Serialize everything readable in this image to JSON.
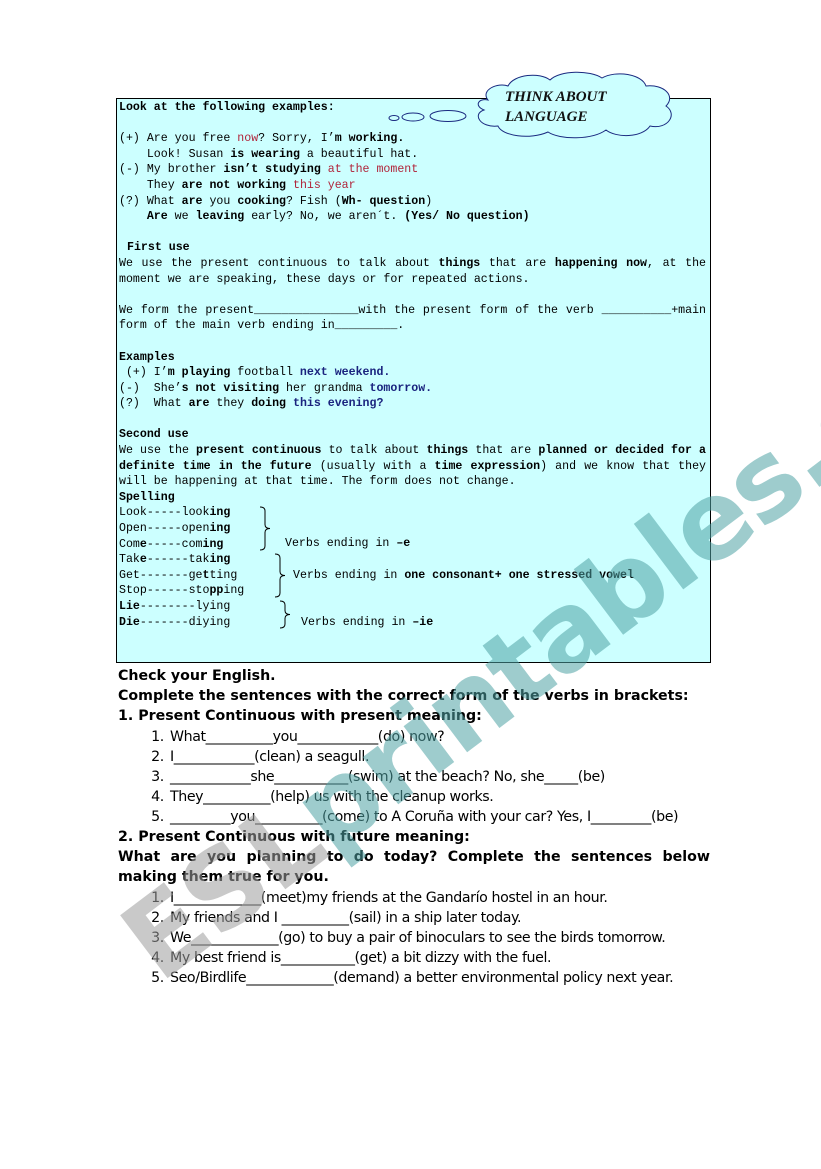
{
  "cloud": {
    "line1": "THINK ABOUT",
    "line2": "LANGUAGE"
  },
  "grammar_box": {
    "intro": "Look at the following examples:",
    "examples": [
      {
        "sign": "(+)",
        "parts": [
          {
            "t": "Are you free ",
            "s": ""
          },
          {
            "t": "now",
            "s": "red"
          },
          {
            "t": "? Sorry, I’",
            "s": ""
          },
          {
            "t": "m working.",
            "s": "b"
          }
        ]
      },
      {
        "sign": "",
        "parts": [
          {
            "t": "Look! Susan ",
            "s": ""
          },
          {
            "t": "is wearing",
            "s": "b"
          },
          {
            "t": " a beautiful hat.",
            "s": ""
          }
        ]
      },
      {
        "sign": "(-)",
        "parts": [
          {
            "t": "My brother ",
            "s": ""
          },
          {
            "t": "isn’t studying",
            "s": "b"
          },
          {
            "t": " ",
            "s": ""
          },
          {
            "t": "at the moment",
            "s": "red"
          }
        ]
      },
      {
        "sign": "",
        "parts": [
          {
            "t": "They ",
            "s": ""
          },
          {
            "t": "are not working",
            "s": "b"
          },
          {
            "t": " ",
            "s": ""
          },
          {
            "t": "this year",
            "s": "red"
          }
        ]
      },
      {
        "sign": "(?)",
        "parts": [
          {
            "t": "What ",
            "s": ""
          },
          {
            "t": "are",
            "s": "b"
          },
          {
            "t": " you ",
            "s": ""
          },
          {
            "t": "cooking",
            "s": "b"
          },
          {
            "t": "? Fish (",
            "s": ""
          },
          {
            "t": "Wh- question",
            "s": "b"
          },
          {
            "t": ")",
            "s": ""
          }
        ]
      },
      {
        "sign": "",
        "parts": [
          {
            "t": "Are",
            "s": "b"
          },
          {
            "t": " we ",
            "s": ""
          },
          {
            "t": "leaving",
            "s": "b"
          },
          {
            "t": " early? No, we aren´t. ",
            "s": ""
          },
          {
            "t": "(Yes/ No question)",
            "s": "b"
          }
        ]
      }
    ],
    "first_use": {
      "heading": "First use",
      "para_parts": [
        {
          "t": "We use the present continuous to talk about ",
          "s": ""
        },
        {
          "t": "things",
          "s": "b"
        },
        {
          "t": " that are ",
          "s": ""
        },
        {
          "t": "happening now",
          "s": "b"
        },
        {
          "t": ", at the moment we are speaking, these days or for repeated actions.",
          "s": ""
        }
      ],
      "form_sentence": "We form the present_______________with the present form of the verb __________+main form of the main verb ending in_________."
    },
    "examples2": {
      "heading": "Examples",
      "items": [
        {
          "sign": " (+)",
          "parts": [
            {
              "t": "I’",
              "s": ""
            },
            {
              "t": "m playing",
              "s": "b"
            },
            {
              "t": " football ",
              "s": ""
            },
            {
              "t": "next weekend.",
              "s": "blue"
            }
          ]
        },
        {
          "sign": "(-) ",
          "parts": [
            {
              "t": "She’",
              "s": ""
            },
            {
              "t": "s not visiting",
              "s": "b"
            },
            {
              "t": " her grandma ",
              "s": ""
            },
            {
              "t": "tomorrow.",
              "s": "blue"
            }
          ]
        },
        {
          "sign": "(?) ",
          "parts": [
            {
              "t": "What ",
              "s": ""
            },
            {
              "t": "are",
              "s": "b"
            },
            {
              "t": " they ",
              "s": ""
            },
            {
              "t": "doing",
              "s": "b"
            },
            {
              "t": " ",
              "s": ""
            },
            {
              "t": "this evening?",
              "s": "blue"
            }
          ]
        }
      ]
    },
    "second_use": {
      "heading": "Second use",
      "para_parts": [
        {
          "t": "We use the ",
          "s": ""
        },
        {
          "t": "present continuous",
          "s": "b"
        },
        {
          "t": " to talk about ",
          "s": ""
        },
        {
          "t": "things",
          "s": "b"
        },
        {
          "t": " that are ",
          "s": ""
        },
        {
          "t": "planned or decided for a definite time in the future",
          "s": "b"
        },
        {
          "t": " (usually with a ",
          "s": ""
        },
        {
          "t": "time expression",
          "s": "b"
        },
        {
          "t": ") and we know that they will be happening at that time. The form does not change.",
          "s": ""
        }
      ]
    },
    "spelling": {
      "heading": "Spelling",
      "rows": [
        {
          "parts": [
            {
              "t": "Look-----look",
              "s": ""
            },
            {
              "t": "ing",
              "s": "b"
            }
          ]
        },
        {
          "parts": [
            {
              "t": "Open-----open",
              "s": ""
            },
            {
              "t": "ing",
              "s": "b"
            }
          ]
        },
        {
          "parts": [
            {
              "t": "Com",
              "s": ""
            },
            {
              "t": "e",
              "s": "b"
            },
            {
              "t": "-----com",
              "s": ""
            },
            {
              "t": "ing",
              "s": "b"
            }
          ]
        },
        {
          "parts": [
            {
              "t": "Tak",
              "s": ""
            },
            {
              "t": "e",
              "s": "b"
            },
            {
              "t": "------tak",
              "s": ""
            },
            {
              "t": "ing",
              "s": "b"
            }
          ]
        },
        {
          "parts": [
            {
              "t": "Get-------ge",
              "s": ""
            },
            {
              "t": "t",
              "s": "b"
            },
            {
              "t": "ting",
              "s": ""
            }
          ]
        },
        {
          "parts": [
            {
              "t": "Stop------sto",
              "s": ""
            },
            {
              "t": "pp",
              "s": "b"
            },
            {
              "t": "ing",
              "s": ""
            }
          ]
        },
        {
          "parts": [
            {
              "t": "Lie",
              "s": "b"
            },
            {
              "t": "--------l",
              "s": ""
            },
            {
              "t": "y",
              "s": ""
            },
            {
              "t": "ing",
              "s": ""
            }
          ]
        },
        {
          "parts": [
            {
              "t": "Die",
              "s": "b"
            },
            {
              "t": "-------diying",
              "s": ""
            }
          ]
        }
      ],
      "notes": [
        {
          "parts": [
            {
              "t": "Verbs ending in ",
              "s": ""
            },
            {
              "t": "–e",
              "s": "b"
            }
          ]
        },
        {
          "parts": [
            {
              "t": "Verbs ending in ",
              "s": ""
            },
            {
              "t": "one consonant+ one stressed vowel",
              "s": "b"
            }
          ]
        },
        {
          "parts": [
            {
              "t": "Verbs ending in ",
              "s": ""
            },
            {
              "t": "–ie",
              "s": "b"
            }
          ]
        }
      ]
    }
  },
  "exercises": {
    "check_heading": "Check your English.",
    "instruction": "Complete the sentences with the correct form of the verbs in brackets:",
    "section1": {
      "title": "1. Present Continuous with present meaning:",
      "items": [
        "What__________you____________(do) now?",
        "I____________(clean) a seagull.",
        "____________she___________(swim) at the beach? No, she_____(be)",
        "They__________(help) us with the cleanup works.",
        "_________you__________(come) to A Coruña with your car? Yes, I_________(be)"
      ]
    },
    "section2": {
      "title": "2. Present Continuous with future meaning:",
      "instruction": "What are you planning to do today? Complete the sentences below making them true for you.",
      "items": [
        "I_____________(meet)my friends at the Gandarío hostel in an hour.",
        "My friends and I __________(sail) in a ship later today.",
        "We_____________(go) to buy a pair of binoculars to see the birds tomorrow.",
        "My best friend is___________(get) a bit dizzy with the fuel.",
        "Seo/Birdlife_____________(demand) a better environmental policy next year."
      ]
    }
  },
  "watermark": {
    "part1": "ESL",
    "part2": "printables.com"
  }
}
